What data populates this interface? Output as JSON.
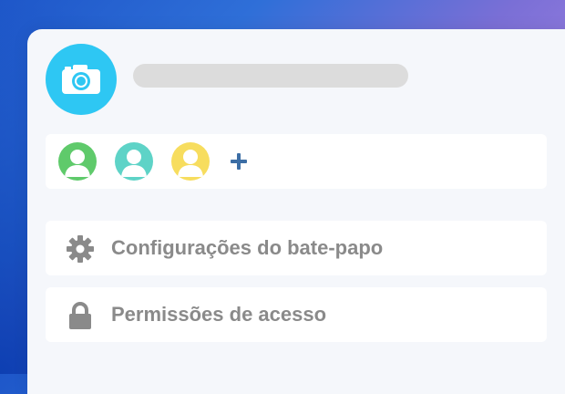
{
  "colors": {
    "camera_button_bg": "#2ec7f3",
    "panel_bg": "#f5f7fb",
    "title_placeholder_bg": "#dcdcdc",
    "avatar_1": "#5fca6b",
    "avatar_2": "#5ed3c7",
    "avatar_3": "#f7dd5e",
    "add_icon": "#3c6ea5",
    "menu_icon": "#8a8a8a",
    "menu_text": "#8a8a8a"
  },
  "header": {
    "camera_icon": "camera-icon",
    "title_placeholder": ""
  },
  "members": {
    "avatars": [
      {
        "icon": "user-avatar-icon",
        "color": "#5fca6b"
      },
      {
        "icon": "user-avatar-icon",
        "color": "#5ed3c7"
      },
      {
        "icon": "user-avatar-icon",
        "color": "#f7dd5e"
      }
    ],
    "add_icon": "plus-icon"
  },
  "menu": {
    "items": [
      {
        "label": "Configurações do bate-papo",
        "icon": "gear-icon"
      },
      {
        "label": "Permissões de acesso",
        "icon": "lock-icon"
      }
    ]
  }
}
